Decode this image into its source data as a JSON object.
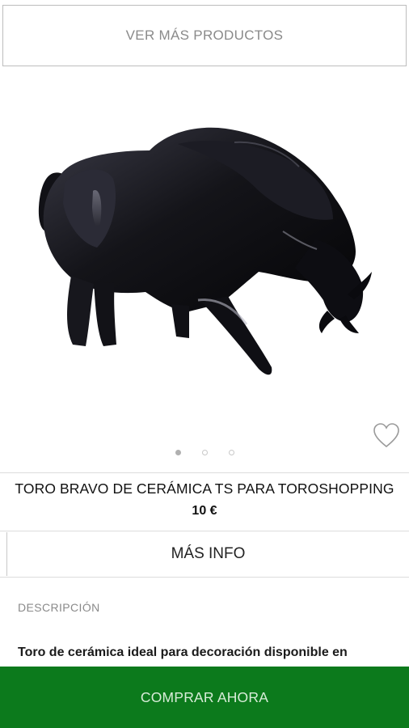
{
  "top": {
    "see_more_label": "VER MÁS PRODUCTOS"
  },
  "gallery": {
    "image_icon": "bull-sculpture-image",
    "page_count": 3,
    "active_page": 1
  },
  "favorite": {
    "icon": "heart-icon"
  },
  "product": {
    "title": "TORO BRAVO DE CERÁMICA TS PARA TOROSHOPPING",
    "price": "10 €"
  },
  "more_info": {
    "label": "MÁS INFO"
  },
  "description": {
    "label": "DESCRIPCIÓN",
    "text": "Toro de cerámica ideal para decoración disponible en"
  },
  "buy": {
    "label": "COMPRAR AHORA"
  },
  "colors": {
    "accent": "#0c7a1c",
    "bull": "#15151c"
  }
}
